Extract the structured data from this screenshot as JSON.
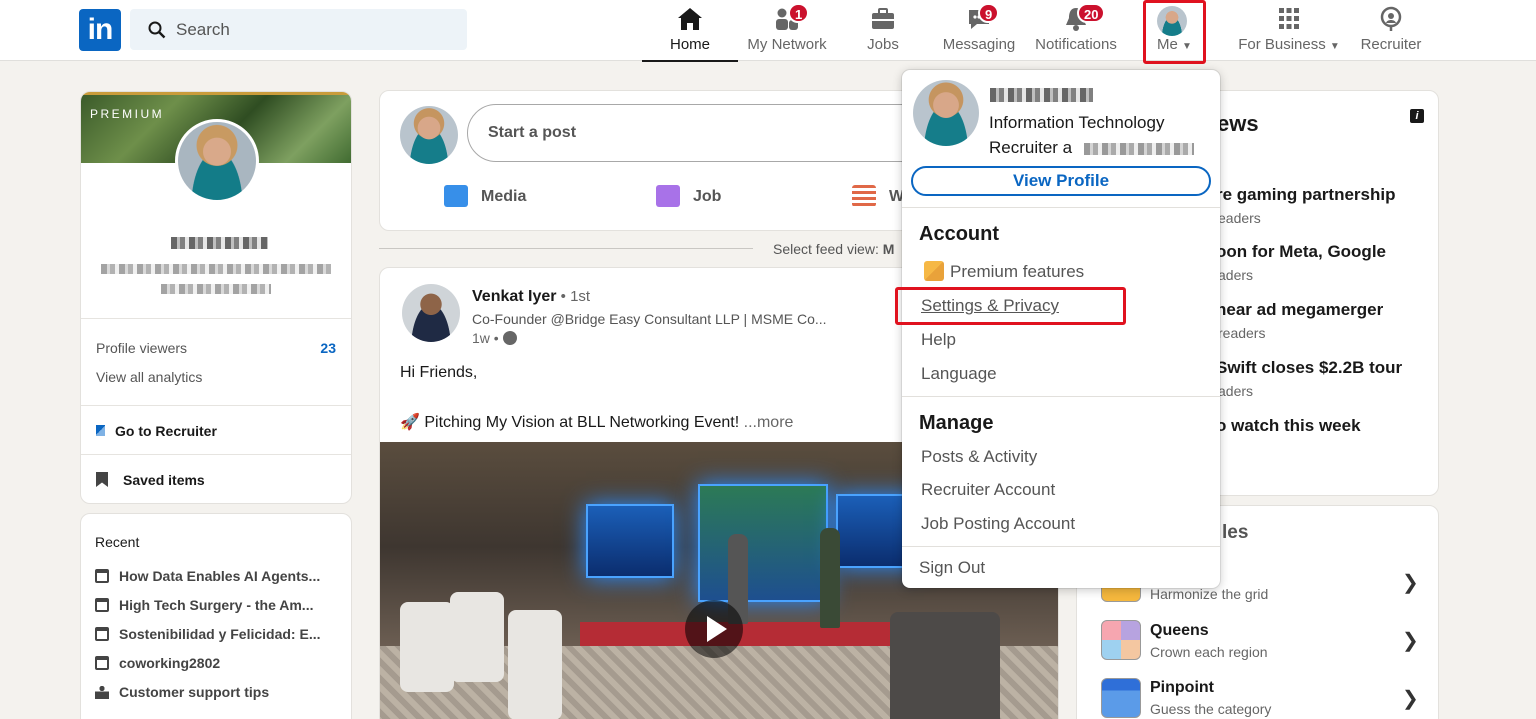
{
  "nav": {
    "search_placeholder": "Search",
    "items": [
      {
        "label": "Home",
        "active": true
      },
      {
        "label": "My Network",
        "badge": "1"
      },
      {
        "label": "Jobs"
      },
      {
        "label": "Messaging",
        "badge": "9"
      },
      {
        "label": "Notifications",
        "badge": "20"
      },
      {
        "label": "Me"
      },
      {
        "label": "For Business"
      },
      {
        "label": "Recruiter"
      }
    ]
  },
  "profile_card": {
    "premium_label": "PREMIUM",
    "profile_viewers_label": "Profile viewers",
    "profile_viewers_count": "23",
    "analytics_label": "View all analytics",
    "go_to_recruiter": "Go to Recruiter",
    "saved_items": "Saved items"
  },
  "recent": {
    "title": "Recent",
    "items": [
      "How Data Enables AI Agents...",
      "High Tech Surgery - the Am...",
      "Sostenibilidad y Felicidad: E...",
      "coworking2802",
      "Customer support tips"
    ]
  },
  "composer": {
    "start_post": "Start a post",
    "media": "Media",
    "job": "Job",
    "write_article": "W"
  },
  "feed_sort": {
    "label": "Select feed view:",
    "value": "M"
  },
  "post": {
    "author": "Venkat Iyer",
    "degree": " • 1st",
    "headline": "Co-Founder @Bridge Easy Consultant LLP | MSME Co...",
    "time": "1w •",
    "greeting": "Hi Friends,",
    "body": "🚀 Pitching My Vision at BLL Networking Event!",
    "more": "...more"
  },
  "news": {
    "title": "ews",
    "items": [
      {
        "title": "re gaming partnership",
        "sub": "eaders"
      },
      {
        "title": "oon for Meta, Google",
        "sub": "aders"
      },
      {
        "title": "near ad megamerger",
        "sub": "readers"
      },
      {
        "title": "Swift closes $2.2B tour",
        "sub": "aders"
      },
      {
        "title": "o watch this week",
        "sub": ""
      }
    ]
  },
  "games": {
    "title": "les",
    "items": [
      {
        "name": "",
        "desc": "Harmonize the grid"
      },
      {
        "name": "Queens",
        "desc": "Crown each region"
      },
      {
        "name": "Pinpoint",
        "desc": "Guess the category"
      }
    ]
  },
  "me_menu": {
    "headline": "Information Technology Recruiter a",
    "view_profile": "View Profile",
    "account_title": "Account",
    "account_items": [
      "Premium features",
      "Settings & Privacy",
      "Help",
      "Language"
    ],
    "manage_title": "Manage",
    "manage_items": [
      "Posts & Activity",
      "Recruiter Account",
      "Job Posting Account"
    ],
    "sign_out": "Sign Out"
  },
  "colors": {
    "brand": "#0a66c2",
    "badge": "#cb112d",
    "highlight": "#e0121f"
  }
}
